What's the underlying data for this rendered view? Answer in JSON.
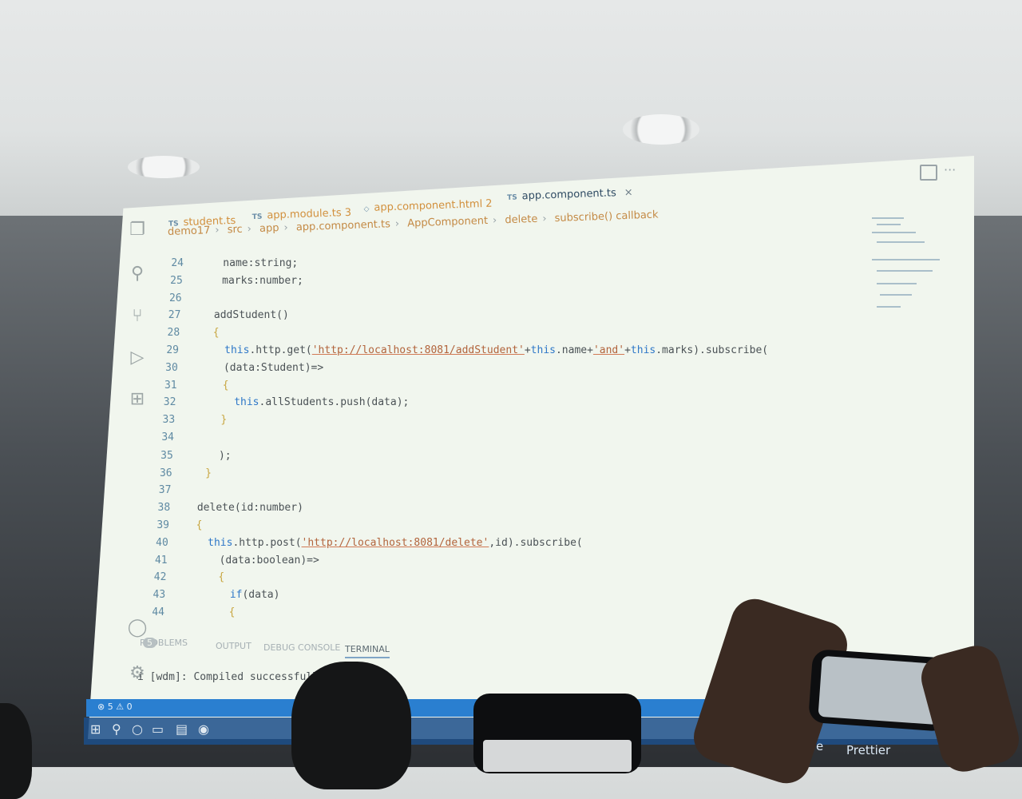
{
  "tabs": [
    {
      "label": "student.ts",
      "active": false
    },
    {
      "label": "app.module.ts 3",
      "active": false
    },
    {
      "label": "app.component.html 2",
      "active": false
    },
    {
      "label": "app.component.ts",
      "active": true,
      "close": "×"
    }
  ],
  "breadcrumb": [
    "demo17",
    "src",
    "app",
    "app.component.ts",
    "AppComponent",
    "delete",
    "subscribe() callback"
  ],
  "code_lines": [
    {
      "n": "24",
      "t": "    name:string;"
    },
    {
      "n": "25",
      "t": "    marks:number;"
    },
    {
      "n": "26",
      "t": ""
    },
    {
      "n": "27",
      "t": "   addStudent()"
    },
    {
      "n": "28",
      "t": "   {"
    },
    {
      "n": "29",
      "t": "     this.http.get('http://localhost:8081/addStudent'+this.name+'and'+this.marks).subscribe("
    },
    {
      "n": "30",
      "t": "     (data:Student)=>"
    },
    {
      "n": "31",
      "t": "     {"
    },
    {
      "n": "32",
      "t": "       this.allStudents.push(data);"
    },
    {
      "n": "33",
      "t": "     }"
    },
    {
      "n": "34",
      "t": ""
    },
    {
      "n": "35",
      "t": "     );"
    },
    {
      "n": "36",
      "t": "   }"
    },
    {
      "n": "37",
      "t": ""
    },
    {
      "n": "38",
      "t": "  delete(id:number)"
    },
    {
      "n": "39",
      "t": "  {"
    },
    {
      "n": "40",
      "t": "    this.http.post('http://localhost:8081/delete',id).subscribe("
    },
    {
      "n": "41",
      "t": "      (data:boolean)=>"
    },
    {
      "n": "42",
      "t": "      {"
    },
    {
      "n": "43",
      "t": "        if(data)"
    },
    {
      "n": "44",
      "t": "        {"
    }
  ],
  "panel_tabs": {
    "problems": "PROBLEMS",
    "problems_count": "5",
    "output": "OUTPUT",
    "debug_console": "DEBUG CONSOLE",
    "terminal": "TERMINAL"
  },
  "terminal_text": "i [wdm]: Compiled successfully.",
  "status": {
    "errors": "⊗ 5 ⚠ 0",
    "go_live": "Go Live",
    "prettier": "Prettier"
  },
  "colors": {
    "status_bar": "#2a7fd0",
    "accent": "#2f78c8",
    "string": "#b2643c"
  }
}
